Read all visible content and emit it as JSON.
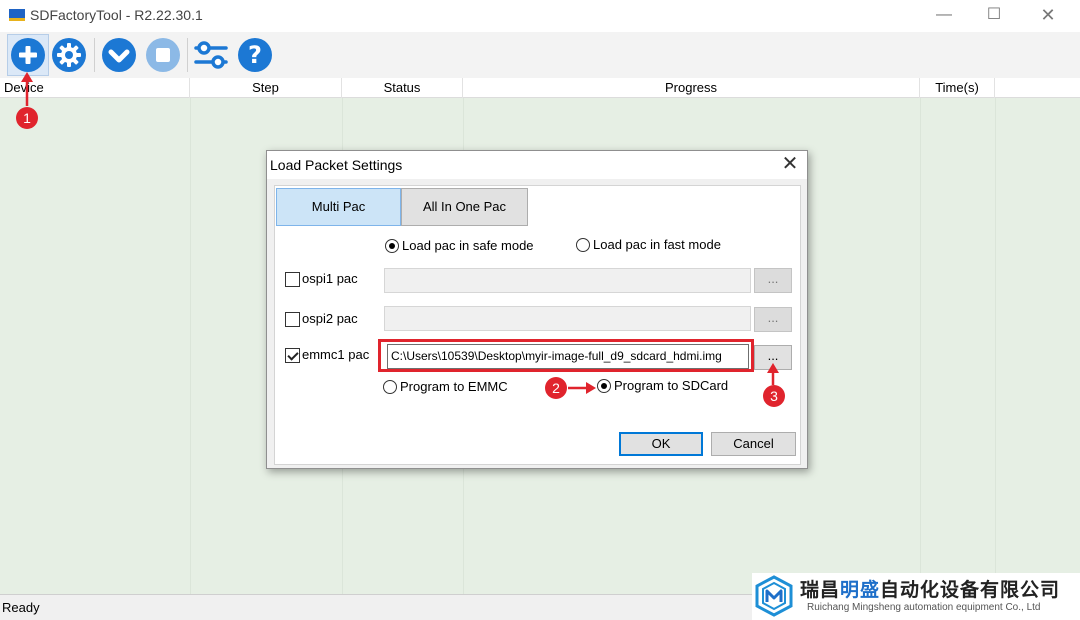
{
  "window": {
    "title": "SDFactoryTool - R2.22.30.1",
    "min_glyph": "—",
    "max_glyph": "☐",
    "close_glyph": "✕"
  },
  "toolbar": {
    "buttons": [
      {
        "icon": "add-icon",
        "color": "#1c78d4"
      },
      {
        "icon": "gear-icon",
        "color": "#1c78d4"
      },
      {
        "icon": "download-icon",
        "color": "#1c78d4"
      },
      {
        "icon": "stop-icon",
        "color": "#8cb9e6"
      },
      {
        "icon": "settings-sliders-icon",
        "color": "#1c78d4"
      },
      {
        "icon": "help-icon",
        "color": "#1c78d4"
      }
    ]
  },
  "grid": {
    "columns": [
      "Device",
      "Step",
      "Status",
      "Progress",
      "Time(s)"
    ]
  },
  "status_bar": {
    "text": "Ready"
  },
  "dialog": {
    "title": "Load Packet Settings",
    "close_glyph": "✕",
    "tabs": [
      {
        "label": "Multi Pac",
        "selected": true
      },
      {
        "label": "All In One Pac",
        "selected": false
      }
    ],
    "load_mode": {
      "options": [
        "Load pac in safe mode",
        "Load pac in fast mode"
      ],
      "selected": "Load pac in safe mode"
    },
    "pacs": [
      {
        "label": "ospi1 pac",
        "checked": false,
        "path": "",
        "browse_label": "..."
      },
      {
        "label": "ospi2 pac",
        "checked": false,
        "path": "",
        "browse_label": "..."
      },
      {
        "label": "emmc1 pac",
        "checked": true,
        "path": "C:\\Users\\10539\\Desktop\\myir-image-full_d9_sdcard_hdmi.img",
        "browse_label": "..."
      }
    ],
    "program_target": {
      "options": [
        "Program to EMMC",
        "Program to SDCard"
      ],
      "selected": "Program to SDCard"
    },
    "ok_label": "OK",
    "cancel_label": "Cancel"
  },
  "annotations": {
    "markers": [
      "1",
      "2",
      "3"
    ],
    "accent_color": "#e0242d"
  },
  "watermark": {
    "company_cn_prefix": "瑞昌",
    "company_cn_brand": "明盛",
    "company_cn_suffix": "自动化设备有限公司",
    "company_en": "Ruichang Mingsheng automation equipment Co., Ltd"
  }
}
